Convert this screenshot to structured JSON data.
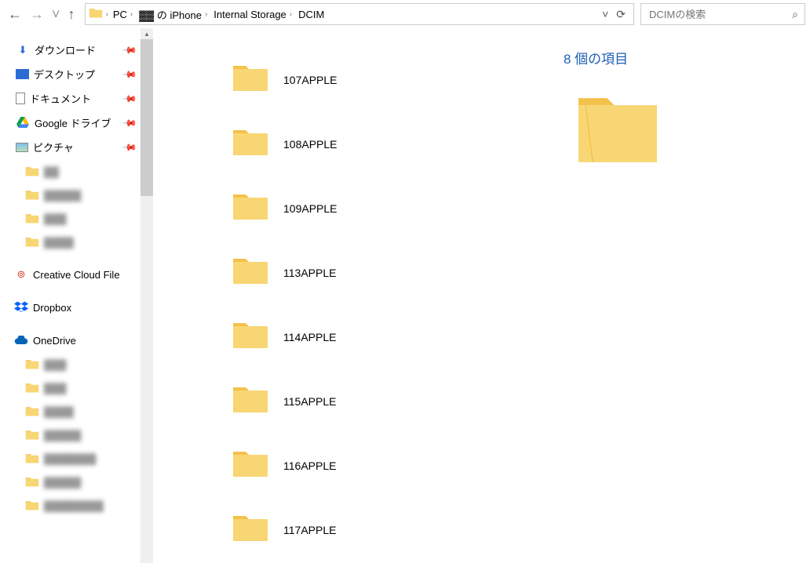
{
  "nav": {
    "back": "←",
    "forward": "→",
    "dropdown": "˅",
    "up": "↑"
  },
  "breadcrumb": {
    "items": [
      "PC",
      "▓▓ の iPhone",
      "Internal Storage",
      "DCIM"
    ],
    "collapse": "˅",
    "refresh": "⟳"
  },
  "search": {
    "placeholder": "DCIMの検索",
    "icon": "⌕"
  },
  "sidebar": {
    "quick": [
      {
        "label": "ダウンロード",
        "pinned": true,
        "icon": "download"
      },
      {
        "label": "デスクトップ",
        "pinned": true,
        "icon": "desktop"
      },
      {
        "label": "ドキュメント",
        "pinned": true,
        "icon": "document"
      },
      {
        "label": "Google ドライブ",
        "pinned": true,
        "icon": "gdrive"
      },
      {
        "label": "ピクチャ",
        "pinned": true,
        "icon": "pictures"
      }
    ],
    "quick_sub": [
      {
        "label": "▓▓",
        "icon": "folder"
      },
      {
        "label": "▓▓▓▓▓",
        "icon": "folder"
      },
      {
        "label": "▓▓▓",
        "icon": "folder"
      },
      {
        "label": "▓▓▓▓",
        "icon": "folder"
      }
    ],
    "roots": [
      {
        "label": "Creative Cloud File",
        "icon": "cc"
      },
      {
        "label": "Dropbox",
        "icon": "dropbox"
      },
      {
        "label": "OneDrive",
        "icon": "onedrive"
      }
    ],
    "onedrive_sub": [
      {
        "label": "▓▓▓",
        "icon": "folder"
      },
      {
        "label": "▓▓▓",
        "icon": "folder"
      },
      {
        "label": "▓▓▓▓",
        "icon": "folder"
      },
      {
        "label": "▓▓▓▓▓",
        "icon": "folder"
      },
      {
        "label": "▓▓▓▓▓▓▓",
        "icon": "folder"
      },
      {
        "label": "▓▓▓▓▓",
        "icon": "folder"
      },
      {
        "label": "▓▓▓▓▓▓▓▓",
        "icon": "folder"
      }
    ]
  },
  "folders": [
    {
      "name": "107APPLE"
    },
    {
      "name": "108APPLE"
    },
    {
      "name": "109APPLE"
    },
    {
      "name": "113APPLE"
    },
    {
      "name": "114APPLE"
    },
    {
      "name": "115APPLE"
    },
    {
      "name": "116APPLE"
    },
    {
      "name": "117APPLE"
    }
  ],
  "preview": {
    "title": "8 個の項目"
  }
}
